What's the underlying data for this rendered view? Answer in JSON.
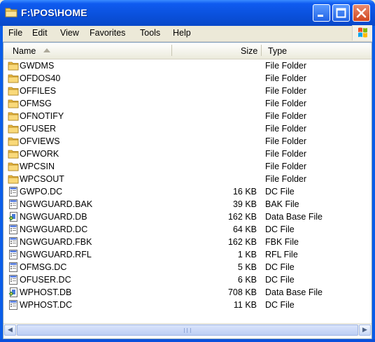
{
  "window": {
    "title": "F:\\POS\\HOME"
  },
  "menu": [
    "File",
    "Edit",
    "View",
    "Favorites",
    "Tools",
    "Help"
  ],
  "columns": {
    "name": "Name",
    "size": "Size",
    "type": "Type"
  },
  "items": [
    {
      "name": "GWDMS",
      "size": "",
      "type": "File Folder",
      "icon": "folder-icon"
    },
    {
      "name": "OFDOS40",
      "size": "",
      "type": "File Folder",
      "icon": "folder-icon"
    },
    {
      "name": "OFFILES",
      "size": "",
      "type": "File Folder",
      "icon": "folder-icon"
    },
    {
      "name": "OFMSG",
      "size": "",
      "type": "File Folder",
      "icon": "folder-icon"
    },
    {
      "name": "OFNOTIFY",
      "size": "",
      "type": "File Folder",
      "icon": "folder-icon"
    },
    {
      "name": "OFUSER",
      "size": "",
      "type": "File Folder",
      "icon": "folder-icon"
    },
    {
      "name": "OFVIEWS",
      "size": "",
      "type": "File Folder",
      "icon": "folder-icon"
    },
    {
      "name": "OFWORK",
      "size": "",
      "type": "File Folder",
      "icon": "folder-icon"
    },
    {
      "name": "WPCSIN",
      "size": "",
      "type": "File Folder",
      "icon": "folder-icon"
    },
    {
      "name": "WPCSOUT",
      "size": "",
      "type": "File Folder",
      "icon": "folder-icon"
    },
    {
      "name": "GWPO.DC",
      "size": "16 KB",
      "type": "DC File",
      "icon": "file-icon"
    },
    {
      "name": "NGWGUARD.BAK",
      "size": "39 KB",
      "type": "BAK File",
      "icon": "file-icon"
    },
    {
      "name": "NGWGUARD.DB",
      "size": "162 KB",
      "type": "Data Base File",
      "icon": "database-file-icon"
    },
    {
      "name": "NGWGUARD.DC",
      "size": "64 KB",
      "type": "DC File",
      "icon": "file-icon"
    },
    {
      "name": "NGWGUARD.FBK",
      "size": "162 KB",
      "type": "FBK File",
      "icon": "file-icon"
    },
    {
      "name": "NGWGUARD.RFL",
      "size": "1 KB",
      "type": "RFL File",
      "icon": "file-icon"
    },
    {
      "name": "OFMSG.DC",
      "size": "5 KB",
      "type": "DC File",
      "icon": "file-icon"
    },
    {
      "name": "OFUSER.DC",
      "size": "6 KB",
      "type": "DC File",
      "icon": "file-icon"
    },
    {
      "name": "WPHOST.DB",
      "size": "708 KB",
      "type": "Data Base File",
      "icon": "database-file-icon"
    },
    {
      "name": "WPHOST.DC",
      "size": "11 KB",
      "type": "DC File",
      "icon": "file-icon"
    }
  ]
}
